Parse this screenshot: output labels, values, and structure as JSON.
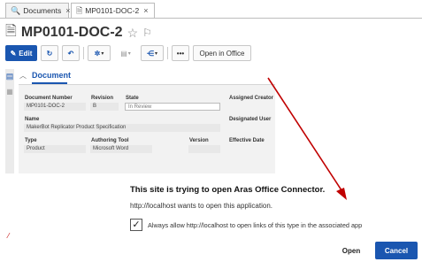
{
  "tabs": [
    {
      "label": "Documents",
      "icon": "search-icon"
    },
    {
      "label": "MP0101-DOC-2",
      "icon": "document-icon"
    }
  ],
  "item": {
    "title": "MP0101-DOC-2"
  },
  "toolbar": {
    "edit_label": "Edit",
    "more_label": "•••",
    "open_in_office_label": "Open in Office"
  },
  "section": {
    "label": "Document"
  },
  "form": {
    "document_number_label": "Document Number",
    "document_number_value": "MP0101-DOC-2",
    "revision_label": "Revision",
    "revision_value": "B",
    "state_label": "State",
    "state_value": "In Review",
    "assigned_creator_label": "Assigned Creator",
    "name_label": "Name",
    "name_value": "MakerBot Replicator Product Specification",
    "designated_user_label": "Designated User",
    "type_label": "Type",
    "type_value": "Product",
    "authoring_tool_label": "Authoring Tool",
    "authoring_tool_value": "Microsoft Word",
    "version_label": "Version",
    "version_value": "",
    "effective_date_label": "Effective Date"
  },
  "dialog": {
    "title": "This site is trying to open Aras Office Connector.",
    "message": "http://localhost wants to open this application.",
    "checkbox_label": "Always allow http://localhost to open links of this type in the associated app",
    "checkbox_checked": true,
    "open_label": "Open",
    "cancel_label": "Cancel"
  },
  "colors": {
    "accent": "#1a56b0",
    "annotation_arrow": "#c00000"
  }
}
